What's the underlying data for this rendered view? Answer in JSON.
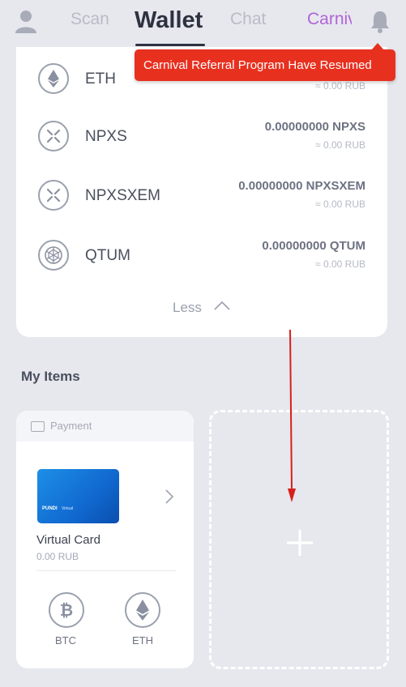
{
  "header": {
    "tabs": [
      {
        "label": "Scan"
      },
      {
        "label": "Wallet"
      },
      {
        "label": "Chat"
      },
      {
        "label": "Carnival"
      }
    ],
    "active_tab": "Wallet",
    "accent_color": "#b264d6"
  },
  "notification": {
    "text": "Carnival Referral Program Have Resumed",
    "color": "#e8301f"
  },
  "coins": [
    {
      "name": "ETH",
      "amount": "",
      "fiat": "≈ 0.00 RUB",
      "icon": "ethereum-icon"
    },
    {
      "name": "NPXS",
      "amount": "0.00000000 NPXS",
      "fiat": "≈ 0.00 RUB",
      "icon": "npxs-icon"
    },
    {
      "name": "NPXSXEM",
      "amount": "0.00000000 NPXSXEM",
      "fiat": "≈ 0.00 RUB",
      "icon": "npxsxem-icon"
    },
    {
      "name": "QTUM",
      "amount": "0.00000000 QTUM",
      "fiat": "≈ 0.00 RUB",
      "icon": "qtum-icon"
    }
  ],
  "less_label": "Less",
  "my_items": {
    "title": "My Items",
    "payment_card": {
      "category": "Payment",
      "card_brand": "PUNDI",
      "card_subtitle": "Virtual",
      "name": "Virtual Card",
      "balance": "0.00 RUB",
      "coins": [
        {
          "label": "BTC",
          "icon": "bitcoin-icon"
        },
        {
          "label": "ETH",
          "icon": "ethereum-icon"
        }
      ]
    }
  }
}
